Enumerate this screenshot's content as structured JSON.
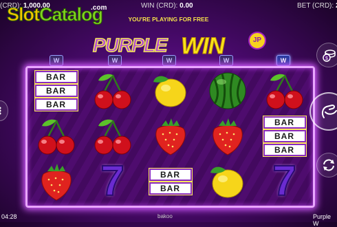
{
  "topbar": {
    "credit_label": "(CRD):",
    "credit_value": "1,000.00",
    "win_label": "WIN (CRD):",
    "win_value": "0.00",
    "bet_label": "BET (CRD):",
    "bet_value": "2"
  },
  "free_play_notice": "YOU'RE PLAYING FOR FREE",
  "watermark": {
    "slot": "Slot",
    "catalog": "Catalog",
    "com": ".com"
  },
  "logo": {
    "purple": "PURPLE",
    "win": "WIN",
    "jp": "JP"
  },
  "reels": [
    [
      "bar3",
      "cherry",
      "strawberry"
    ],
    [
      "cherry",
      "cherry",
      "seven"
    ],
    [
      "lemon",
      "strawberry",
      "bar2"
    ],
    [
      "watermelon",
      "strawberry",
      "lemon"
    ],
    [
      "cherry",
      "bar3",
      "seven"
    ]
  ],
  "symbol_text": {
    "bar": "BAR",
    "seven": "7"
  },
  "wild_badge": "W",
  "bottom": {
    "time": "04:28",
    "provider": "bakoo",
    "game_name": "Purple W"
  },
  "colors": {
    "accent": "#e9a6ff",
    "background": "#4a0a6e",
    "gold": "#f9e21a"
  }
}
